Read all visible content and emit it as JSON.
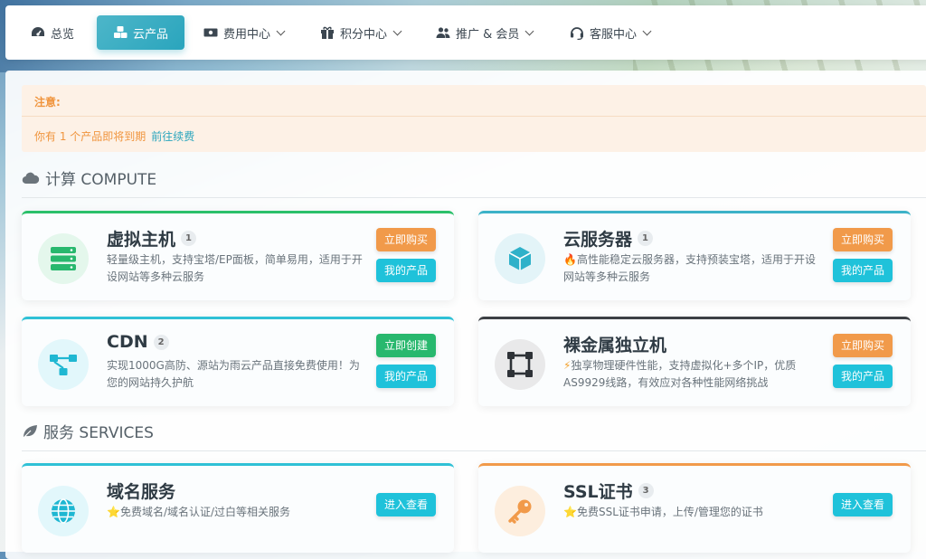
{
  "nav": {
    "items": [
      {
        "label": "总览",
        "icon": "dashboard-icon"
      },
      {
        "label": "云产品",
        "icon": "cubes-icon",
        "active": true
      },
      {
        "label": "费用中心",
        "icon": "money-icon",
        "dropdown": true
      },
      {
        "label": "积分中心",
        "icon": "gift-icon",
        "dropdown": true
      },
      {
        "label": "推广 & 会员",
        "icon": "users-icon",
        "dropdown": true
      },
      {
        "label": "客服中心",
        "icon": "headset-icon",
        "dropdown": true
      }
    ]
  },
  "notice": {
    "title": "注意:",
    "text": "你有 1 个产品即将到期",
    "link": "前往续费"
  },
  "sections": {
    "compute": "计算 COMPUTE",
    "services": "服务 SERVICES"
  },
  "cards": {
    "vhost": {
      "title": "虚拟主机",
      "count": "1",
      "desc": "轻量级主机，支持宝塔/EP面板，简单易用，适用于开设网站等多种云服务",
      "btn1": "立即购买",
      "btn2": "我的产品"
    },
    "cloud": {
      "title": "云服务器",
      "count": "1",
      "desc": "高性能稳定云服务器，支持预装宝塔，适用于开设网站等多种云服务",
      "btn1": "立即购买",
      "btn2": "我的产品"
    },
    "cdn": {
      "title": "CDN",
      "count": "2",
      "desc": "实现1000G高防、源站为雨云产品直接免费使用！为您的网站持久护航",
      "btn1": "立即创建",
      "btn2": "我的产品"
    },
    "baremetal": {
      "title": "裸金属独立机",
      "desc": "独享物理硬件性能，支持虚拟化+多个IP，优质AS9929线路，有效应对各种性能网络挑战",
      "btn1": "立即购买",
      "btn2": "我的产品"
    },
    "domain": {
      "title": "域名服务",
      "desc": "免费域名/域名认证/过白等相关服务",
      "btn1": "进入查看"
    },
    "ssl": {
      "title": "SSL证书",
      "count": "3",
      "desc": "免费SSL证书申请，上传/管理您的证书",
      "btn1": "进入查看"
    }
  },
  "colors": {
    "accent": "#2aa5bd",
    "orange": "#f19a4a",
    "green": "#28b86e",
    "notice_bg": "#fdf1e6"
  }
}
